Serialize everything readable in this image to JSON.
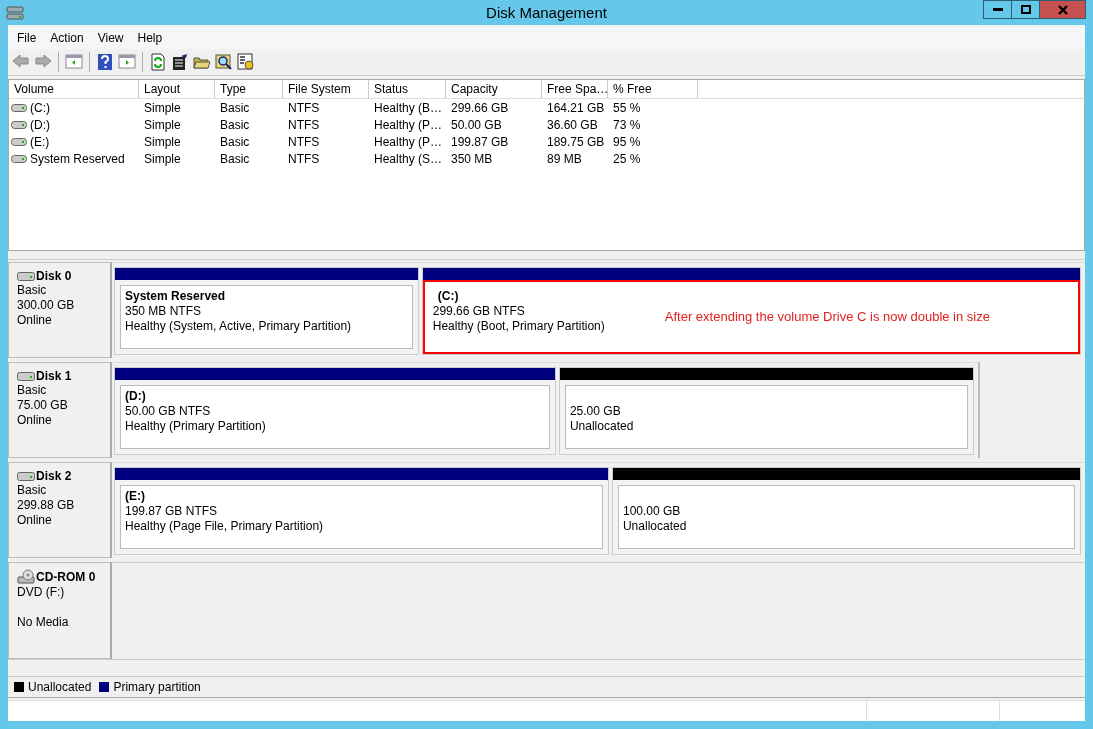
{
  "window": {
    "title": "Disk Management"
  },
  "menu": [
    "File",
    "Action",
    "View",
    "Help"
  ],
  "volume_table": {
    "columns": [
      "Volume",
      "Layout",
      "Type",
      "File System",
      "Status",
      "Capacity",
      "Free Spa…",
      "% Free"
    ],
    "rows": [
      {
        "cells": [
          "(C:)",
          "Simple",
          "Basic",
          "NTFS",
          "Healthy (B…",
          "299.66 GB",
          "164.21 GB",
          "55 %"
        ]
      },
      {
        "cells": [
          "(D:)",
          "Simple",
          "Basic",
          "NTFS",
          "Healthy (P…",
          "50.00 GB",
          "36.60 GB",
          "73 %"
        ]
      },
      {
        "cells": [
          "(E:)",
          "Simple",
          "Basic",
          "NTFS",
          "Healthy (P…",
          "199.87 GB",
          "189.75 GB",
          "95 %"
        ]
      },
      {
        "cells": [
          "System Reserved",
          "Simple",
          "Basic",
          "NTFS",
          "Healthy (S…",
          "350 MB",
          "89 MB",
          "25 %"
        ]
      }
    ]
  },
  "disks": [
    {
      "kind": "disk",
      "name": "Disk 0",
      "lines": [
        "Basic",
        "300.00 GB",
        "Online"
      ],
      "partitions": [
        {
          "kind": "primary",
          "name": "System Reserved",
          "lines": [
            "350 MB NTFS",
            "Healthy (System, Active, Primary Partition)"
          ],
          "highlighted": false
        },
        {
          "kind": "primary",
          "name": "(C:)",
          "lines": [
            "299.66 GB NTFS",
            "Healthy (Boot, Primary Partition)"
          ],
          "highlighted": true,
          "annotation": "After extending the volume Drive C is now double in size"
        }
      ]
    },
    {
      "kind": "disk",
      "name": "Disk 1",
      "lines": [
        "Basic",
        "75.00 GB",
        "Online"
      ],
      "partitions": [
        {
          "kind": "primary",
          "name": "(D:)",
          "lines": [
            "50.00 GB NTFS",
            "Healthy (Primary Partition)"
          ],
          "highlighted": false
        },
        {
          "kind": "unallocated",
          "lines": [
            "25.00 GB",
            "Unallocated"
          ],
          "highlighted": false
        }
      ]
    },
    {
      "kind": "disk",
      "name": "Disk 2",
      "lines": [
        "Basic",
        "299.88 GB",
        "Online"
      ],
      "partitions": [
        {
          "kind": "primary",
          "name": "(E:)",
          "lines": [
            "199.87 GB NTFS",
            "Healthy (Page File, Primary Partition)"
          ],
          "highlighted": false
        },
        {
          "kind": "unallocated",
          "lines": [
            "100.00 GB",
            "Unallocated"
          ],
          "highlighted": false
        }
      ]
    },
    {
      "kind": "cdrom",
      "name": "CD-ROM 0",
      "lines": [
        "DVD (F:)",
        "No Media"
      ]
    }
  ],
  "legend": [
    {
      "label": "Unallocated",
      "color": "#000000"
    },
    {
      "label": "Primary partition",
      "color": "#00007f"
    }
  ]
}
